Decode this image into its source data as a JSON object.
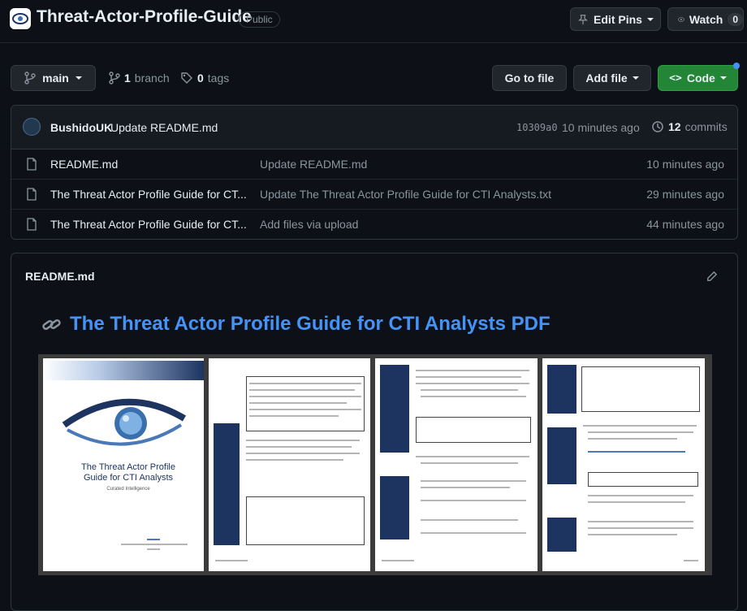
{
  "repo": {
    "name": "Threat-Actor-Profile-Guide",
    "visibility": "Public"
  },
  "actions": {
    "edit_pins": "Edit Pins",
    "watch": "Watch",
    "watch_count": "0"
  },
  "toolbar": {
    "branch_name": "main",
    "branch_count": "1",
    "branch_label": "branch",
    "tag_count": "0",
    "tag_label": "tags",
    "go_to_file": "Go to file",
    "add_file": "Add file",
    "code": "Code"
  },
  "latest_commit": {
    "author": "BushidoUK",
    "message": "Update README.md",
    "sha": "10309a0",
    "time": "10 minutes ago",
    "commit_count": "12",
    "commit_label": "commits"
  },
  "files": [
    {
      "name": "README.md",
      "message": "Update README.md",
      "time": "10 minutes ago"
    },
    {
      "name": "The Threat Actor Profile Guide for CT...",
      "message": "Update The Threat Actor Profile Guide for CTI Analysts.txt",
      "time": "29 minutes ago"
    },
    {
      "name": "The Threat Actor Profile Guide for CT...",
      "message": "Add files via upload",
      "time": "44 minutes ago"
    }
  ],
  "readme": {
    "file_label": "README.md",
    "heading": "The Threat Actor Profile Guide for CTI Analysts PDF",
    "cover_title": "The Threat Actor Profile Guide for CTI Analysts",
    "cover_subtitle": "Curated Intelligence"
  },
  "colors": {
    "background": "#0d1117",
    "link": "#4493f8",
    "code_button": "#238636",
    "cover_navy": "#1d3461"
  }
}
